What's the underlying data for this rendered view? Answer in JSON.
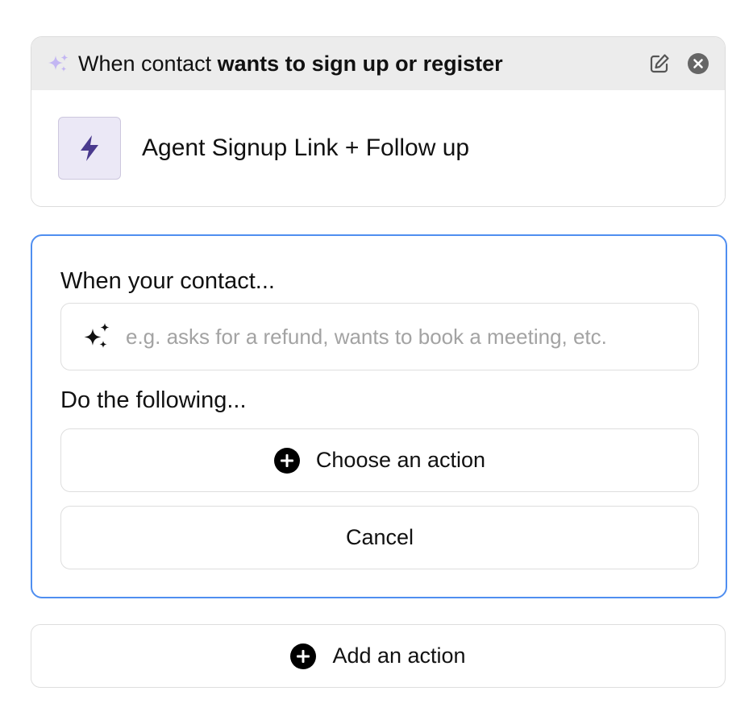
{
  "rule": {
    "title_prefix": "When contact ",
    "title_condition": "wants to sign up or register",
    "action_name": "Agent Signup Link + Follow up",
    "icons": {
      "header": "sparkles-icon",
      "edit": "edit-icon",
      "close": "close-circle-icon",
      "action": "lightning-bolt-icon"
    },
    "colors": {
      "header_sparkle": "#c3b6f3",
      "bolt": "#4a3a8e",
      "bolt_tile_bg": "#ebe8f6"
    }
  },
  "editor": {
    "when_label": "When your contact...",
    "trigger_placeholder": "e.g. asks for a refund, wants to book a meeting, etc.",
    "trigger_value": "",
    "do_label": "Do the following...",
    "choose_action_label": "Choose an action",
    "cancel_label": "Cancel",
    "border_color": "#4f8ef0"
  },
  "footer": {
    "add_action_label": "Add an action"
  }
}
